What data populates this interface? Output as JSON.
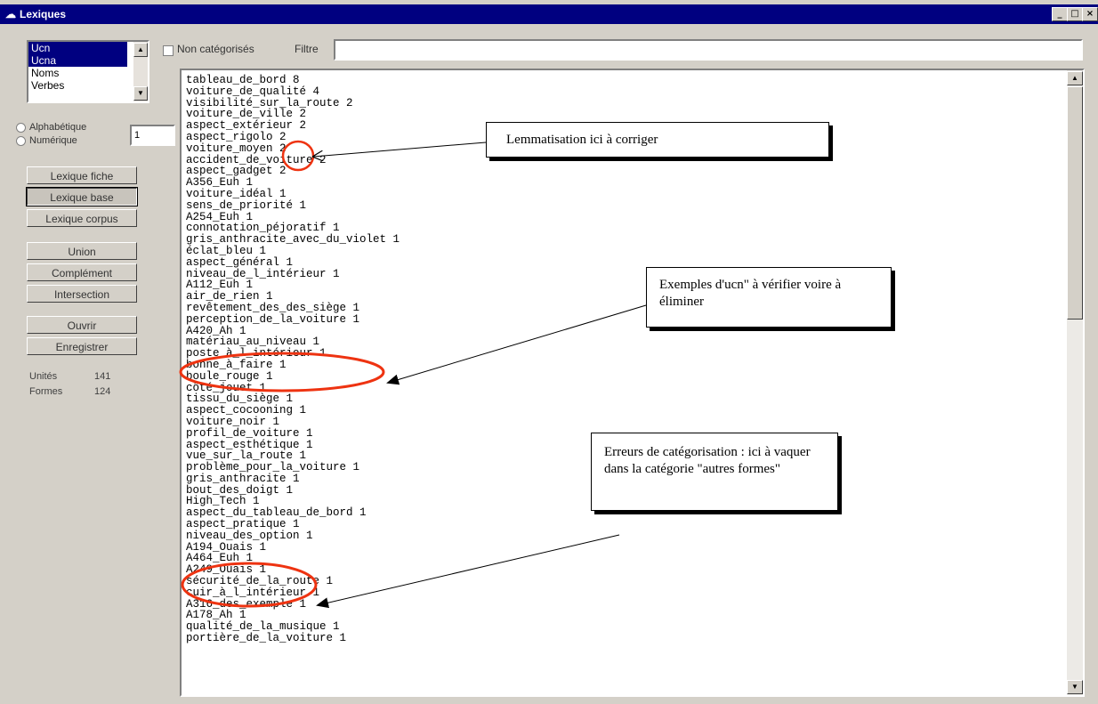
{
  "window": {
    "title": "Lexiques",
    "controls": [
      "_",
      "□",
      "×"
    ]
  },
  "category_list": {
    "items": [
      "Ucn",
      "Ucna",
      "Noms",
      "Verbes"
    ],
    "selected": [
      "Ucn",
      "Ucna"
    ]
  },
  "sort": {
    "alphabetique_label": "Alphabétique",
    "numerique_label": "Numérique",
    "min_value": "1"
  },
  "buttons": {
    "lexique_fiche": "Lexique fiche",
    "lexique_base": "Lexique base",
    "lexique_corpus": "Lexique corpus",
    "union": "Union",
    "complement": "Complément",
    "intersection": "Intersection",
    "ouvrir": "Ouvrir",
    "enregistrer": "Enregistrer"
  },
  "stats": {
    "unites_label": "Unités",
    "unites_value": "141",
    "formes_label": "Formes",
    "formes_value": "124"
  },
  "filter": {
    "non_categorises_label": "Non catégorisés",
    "filtre_label": "Filtre",
    "filtre_value": ""
  },
  "lexicon_lines": [
    "tableau_de_bord 8",
    "voiture_de_qualité 4",
    "visibilité_sur_la_route 2",
    "voiture_de_ville 2",
    "aspect_extérieur 2",
    "aspect_rigolo 2",
    "voiture_moyen 2",
    "accident_de_voiture 2",
    "aspect_gadget 2",
    "A356_Euh 1",
    "voiture_idéal 1",
    "sens_de_priorité 1",
    "A254_Euh 1",
    "connotation_péjoratif 1",
    "gris_anthracite_avec_du_violet 1",
    "éclat_bleu 1",
    "aspect_général 1",
    "niveau_de_l_intérieur 1",
    "A112_Euh 1",
    "air_de_rien 1",
    "revêtement_des_des_siège 1",
    "perception_de_la_voiture 1",
    "A420_Ah 1",
    "matériau_au_niveau 1",
    "poste_à_l_intérieur 1",
    "bonne_à_faire 1",
    "boule_rouge 1",
    "côté_jouet 1",
    "tissu_du_siège 1",
    "aspect_cocooning 1",
    "voiture_noir 1",
    "profil_de_voiture 1",
    "aspect_esthétique 1",
    "vue_sur_la_route 1",
    "problème_pour_la_voiture 1",
    "gris_anthracite 1",
    "bout_des_doigt 1",
    "High_Tech 1",
    "aspect_du_tableau_de_bord 1",
    "aspect_pratique 1",
    "niveau_des_option 1",
    "A194_Ouais 1",
    "A464_Euh 1",
    "A249_Ouais 1",
    "sécurité_de_la_route 1",
    "cuir_à_l_intérieur 1",
    "A316_des_exemple 1",
    "A178_Ah 1",
    "qualité_de_la_musique 1",
    "portière_de_la_voiture 1"
  ],
  "annotations": {
    "callout_lemmatisation": "Lemmatisation ici à corriger",
    "callout_exemples": "Exemples d'ucn\" à vérifier voire à éliminer",
    "callout_erreurs": "Erreurs de catégorisation : ici à vaquer dans la catégorie \"autres formes\"",
    "color": "#ee3311"
  }
}
